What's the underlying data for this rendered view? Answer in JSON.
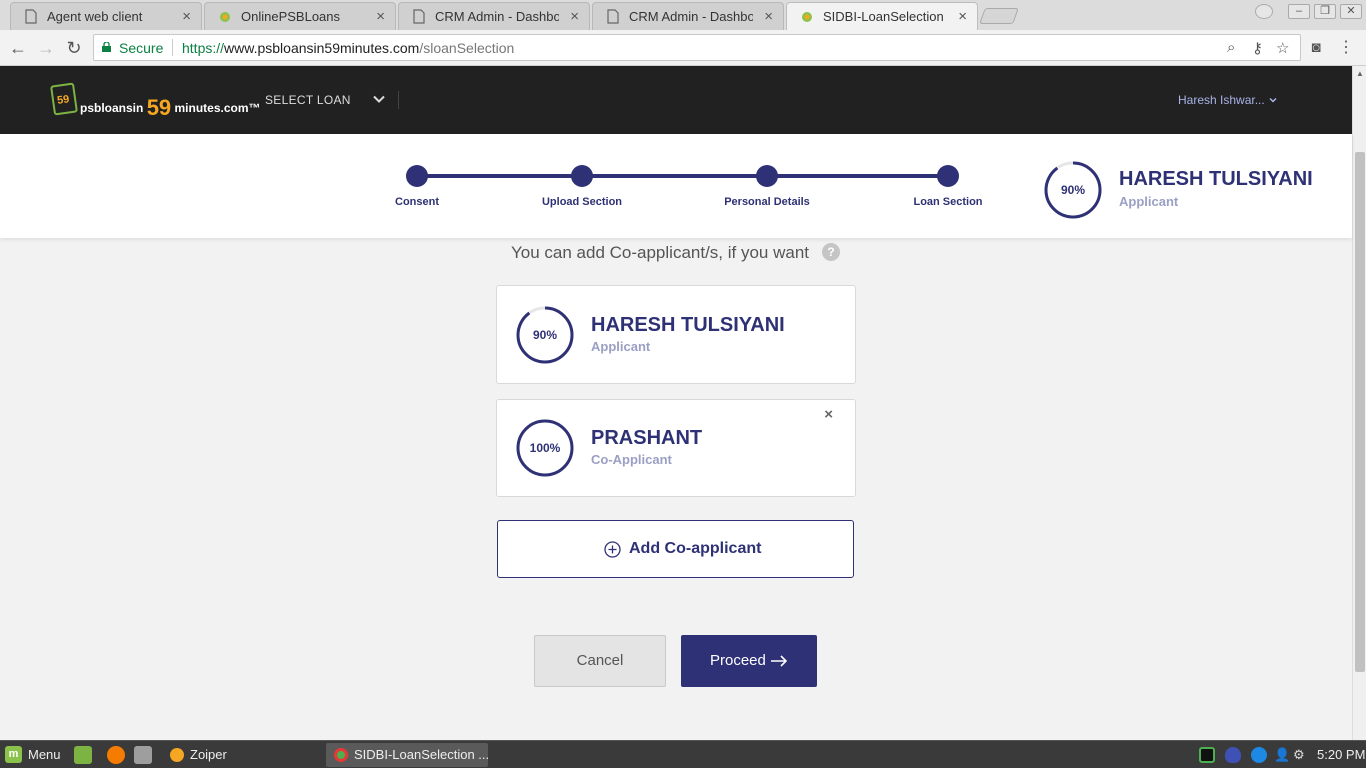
{
  "browser": {
    "tabs": [
      {
        "title": "Agent web client",
        "icon": "page-icon",
        "active": false
      },
      {
        "title": "OnlinePSBLoans",
        "icon": "site-favicon",
        "active": false
      },
      {
        "title": "CRM Admin - Dashboard",
        "icon": "page-icon",
        "active": false
      },
      {
        "title": "CRM Admin - Dashboard",
        "icon": "page-icon",
        "active": false
      },
      {
        "title": "SIDBI-LoanSelection",
        "icon": "site-favicon",
        "active": true
      }
    ],
    "close_glyph": "×",
    "secure_label": "Secure",
    "url_scheme": "https://",
    "url_host": "www.psbloansin59minutes.com",
    "url_path": "/sloanSelection"
  },
  "header": {
    "logo_text_prefix": "psbloansin",
    "logo_text_number": "59",
    "logo_text_suffix": "minutes.com™",
    "logo_badge": "59",
    "select_loan_label": "SELECT LOAN",
    "user_name": "Haresh Ishwar..."
  },
  "stepper": {
    "steps": [
      {
        "label": "Consent"
      },
      {
        "label": "Upload Section"
      },
      {
        "label": "Personal Details"
      },
      {
        "label": "Loan Section"
      }
    ],
    "applicant_progress_text": "90%",
    "applicant_progress": 0.9,
    "applicant_name": "HARESH TULSIYANI",
    "applicant_role": "Applicant"
  },
  "main": {
    "hint_text": "You can add Co-applicant/s, if you want",
    "help_glyph": "?",
    "applicants": [
      {
        "name": "HARESH TULSIYANI",
        "role": "Applicant",
        "progress_text": "90%",
        "progress": 0.9,
        "removable": false
      },
      {
        "name": "PRASHANT",
        "role": "Co-Applicant",
        "progress_text": "100%",
        "progress": 1.0,
        "removable": true
      }
    ],
    "remove_glyph": "×",
    "add_coapplicant_label": "Add Co-applicant",
    "cancel_label": "Cancel",
    "proceed_label": "Proceed"
  },
  "taskbar": {
    "menu_label": "Menu",
    "tasks": [
      {
        "label": "Zoiper"
      },
      {
        "label": "SIDBI-LoanSelection ..."
      }
    ],
    "clock": "5:20 PM"
  },
  "colors": {
    "primary": "#2e3175",
    "header_bg": "#212121",
    "accent_orange": "#f5a623",
    "secure_green": "#0b8043"
  }
}
